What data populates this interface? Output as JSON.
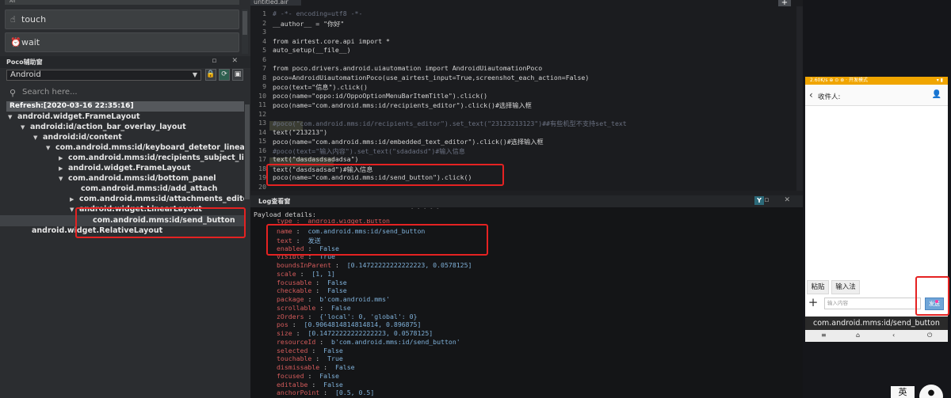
{
  "left_panel": {
    "top_truncated": "All",
    "touch_label": "touch",
    "wait_label": "wait",
    "poco_title": "Poco辅助窗",
    "mode": "Android",
    "search_placeholder": "Search here...",
    "refresh": "Refresh:[2020-03-16 22:35:16]",
    "tree": [
      "android.widget.FrameLayout",
      "android:id/action_bar_overlay_layout",
      "android:id/content",
      "com.android.mms:id/keyboard_detetor_linearla...",
      "com.android.mms:id/recipients_subject_linear",
      "android.widget.FrameLayout",
      "com.android.mms:id/bottom_panel",
      "com.android.mms:id/add_attach",
      "com.android.mms:id/attachments_editor",
      "android.widget.LinearLayout",
      "com.android.mms:id/send_button",
      "android.widget.RelativeLayout"
    ]
  },
  "editor": {
    "tab": "untitled.air",
    "lines": [
      "# -*- encoding=utf8 -*-",
      "__author__ = \"你好\"",
      "",
      "from airtest.core.api import *",
      "auto_setup(__file__)",
      "",
      "from poco.drivers.android.uiautomation import AndroidUiautomationPoco",
      "poco=AndroidUiautomationPoco(use_airtest_input=True,screenshot_each_action=False)",
      "poco(text=\"信息\").click()",
      "poco(name=\"oppo:id/OppoOptionMenuBarItemTitle\").click()",
      "poco(name=\"com.android.mms:id/recipients_editor\").click()#选择输入框",
      "",
      "#poco(\"com.android.mms:id/recipients_editor\").set_text(\"23123213123\")##有些机型不支持set_text",
      "text(\"213213\")",
      "poco(name=\"com.android.mms:id/embedded_text_editor\").click()#选择输入框",
      "#poco(text=\"输入内容\").set_text(\"sdadadsd\")#输入信息",
      "text(\"dasdasdsadadsa\")",
      "text(\"dasdsadsad\")#输入信息",
      "poco(name=\"com.android.mms:id/send_button\").click()",
      ""
    ]
  },
  "log": {
    "title": "Log查看窗",
    "payload_title": "Payload details:",
    "partial_first": "type :  android.widget.Button",
    "entries": [
      {
        "k": "name",
        "v": "com.android.mms:id/send_button"
      },
      {
        "k": "text",
        "v": "发送"
      },
      {
        "k": "enabled",
        "v": "False"
      },
      {
        "k": "visible",
        "v": "True"
      },
      {
        "k": "boundsInParent",
        "v": "[0.14722222222222223, 0.0578125]"
      },
      {
        "k": "scale",
        "v": "[1, 1]"
      },
      {
        "k": "focusable",
        "v": "False"
      },
      {
        "k": "checkable",
        "v": "False"
      },
      {
        "k": "package",
        "v": "b'com.android.mms'"
      },
      {
        "k": "scrollable",
        "v": "False"
      },
      {
        "k": "zOrders",
        "v": "{'local': 0, 'global': 0}"
      },
      {
        "k": "pos",
        "v": "[0.9064814814814814, 0.896875]"
      },
      {
        "k": "size",
        "v": "[0.14722222222222223, 0.0578125]"
      },
      {
        "k": "resourceId",
        "v": "b'com.android.mms:id/send_button'"
      },
      {
        "k": "selected",
        "v": "False"
      },
      {
        "k": "touchable",
        "v": "True"
      },
      {
        "k": "dismissable",
        "v": "False"
      },
      {
        "k": "focused",
        "v": "False"
      },
      {
        "k": "editalbe",
        "v": "False"
      },
      {
        "k": "anchorPoint",
        "v": "[0.5, 0.5]"
      }
    ]
  },
  "phone": {
    "status_left": "2.60K/s ⊕ ⊙ ⊛ · 开发模式",
    "status_right": "▾ ▮",
    "recipient_label": "收件人:",
    "paste": "粘贴",
    "input_method": "输入法",
    "input_placeholder": "输入内容",
    "send": "发送",
    "tooltip": "com.android.mms:id/send_button"
  },
  "ime": {
    "lang": "英"
  },
  "colors": {
    "highlight_box": "#e52222",
    "status_bar": "#f0a500"
  }
}
